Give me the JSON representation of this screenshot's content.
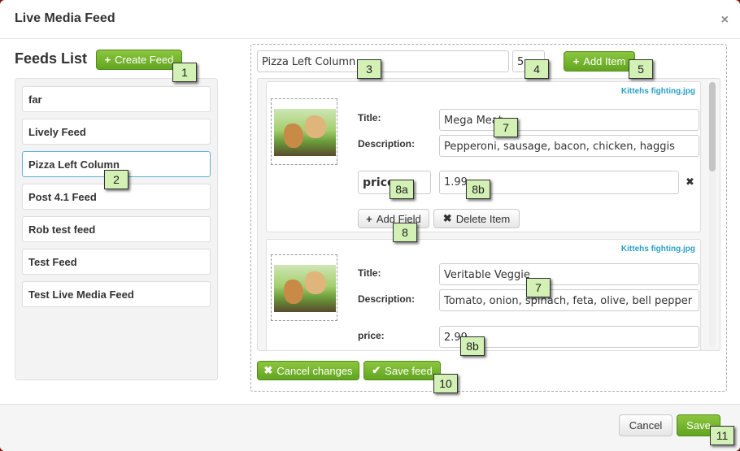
{
  "dialog": {
    "title": "Live Media Feed",
    "close_glyph": "×"
  },
  "feeds": {
    "title": "Feeds List",
    "create_button": "Create Feed",
    "items": [
      {
        "label": "far"
      },
      {
        "label": "Lively Feed"
      },
      {
        "label": "Pizza Left Column"
      },
      {
        "label": "Post 4.1 Feed"
      },
      {
        "label": "Rob test feed"
      },
      {
        "label": "Test Feed"
      },
      {
        "label": "Test Live Media Feed"
      }
    ],
    "selected_index": 2
  },
  "editor": {
    "feed_name": "Pizza Left Column",
    "item_count": "5",
    "add_item_button": "Add Item",
    "items": [
      {
        "file": "Kittehs fighting.jpg",
        "title_label": "Title:",
        "title": "Mega Meat",
        "description_label": "Description:",
        "description": "Pepperoni, sausage, bacon, chicken, haggis",
        "custom_field_name": "price",
        "custom_field_value": "1.99",
        "remove_field_glyph": "✖",
        "add_field_button": "Add Field",
        "delete_item_button": "Delete Item"
      },
      {
        "file": "Kittehs fighting.jpg",
        "title_label": "Title:",
        "title": "Veritable Veggie",
        "description_label": "Description:",
        "description": "Tomato, onion, spinach, feta, olive, bell pepper",
        "custom_field_name": "price:",
        "custom_field_value": "2.99"
      }
    ],
    "cancel_button": "Cancel changes",
    "save_feed_button": "Save feed"
  },
  "footer": {
    "cancel_button": "Cancel",
    "save_button": "Save"
  },
  "annotations": {
    "a1": "1",
    "a2": "2",
    "a3": "3",
    "a4": "4",
    "a5": "5",
    "a7_top": "7",
    "a7_bottom": "7",
    "a8": "8",
    "a8a": "8a",
    "a8b_top": "8b",
    "a8b_bottom": "8b",
    "a10": "10",
    "a11": "11"
  },
  "colors": {
    "accent_green": "#62a521",
    "link_blue": "#2aa0c9",
    "annotation_bg": "#d3f0b5"
  },
  "icons": {
    "plus": "+",
    "cross": "✖",
    "check": "✔"
  }
}
